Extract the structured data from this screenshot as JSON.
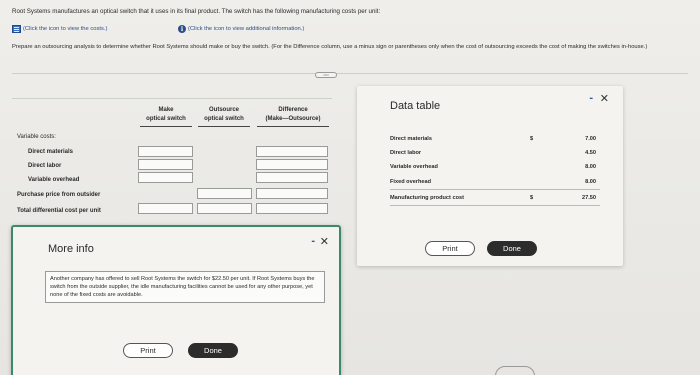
{
  "intro": {
    "text": "Root Systems manufactures an optical switch that it uses in its final product. The switch has the following manufacturing costs per unit:",
    "link_costs": "(Click the icon to view the costs.)",
    "link_info": "(Click the icon to view additional information.)",
    "prepare": "Prepare an outsourcing analysis to determine whether Root Systems should make or buy the switch. (For the Difference column, use a minus sign or parentheses only when the cost of outsourcing exceeds the cost of making the switches in-house.)"
  },
  "analysis": {
    "col_make": [
      "Make",
      "optical switch"
    ],
    "col_outsource": [
      "Outsource",
      "optical switch"
    ],
    "col_difference": [
      "Difference",
      "(Make—Outsource)"
    ],
    "rows": {
      "variable_costs": "Variable costs:",
      "direct_materials": "Direct materials",
      "direct_labor": "Direct labor",
      "variable_overhead": "Variable overhead",
      "purchase_price": "Purchase price from outsider",
      "total": "Total differential cost per unit"
    }
  },
  "more_info": {
    "title": "More info",
    "text": "Another company has offered to sell Root Systems the switch for $22.50 per unit. If Root Systems buys the switch from the outside supplier, the idle manufacturing facilities cannot be used for any other purpose, yet none of the fixed costs are avoidable.",
    "print": "Print",
    "done": "Done",
    "minimize": "-",
    "close": "✕"
  },
  "data_table": {
    "title": "Data table",
    "minimize": "-",
    "close": "✕",
    "rows": [
      {
        "label": "Direct materials",
        "currency": "$",
        "amount": "7.00"
      },
      {
        "label": "Direct labor",
        "currency": "",
        "amount": "4.50"
      },
      {
        "label": "Variable overhead",
        "currency": "",
        "amount": "8.00"
      },
      {
        "label": "Fixed overhead",
        "currency": "",
        "amount": "8.00"
      },
      {
        "label": "Manufacturing product cost",
        "currency": "$",
        "amount": "27.50"
      }
    ],
    "print": "Print",
    "done": "Done"
  }
}
